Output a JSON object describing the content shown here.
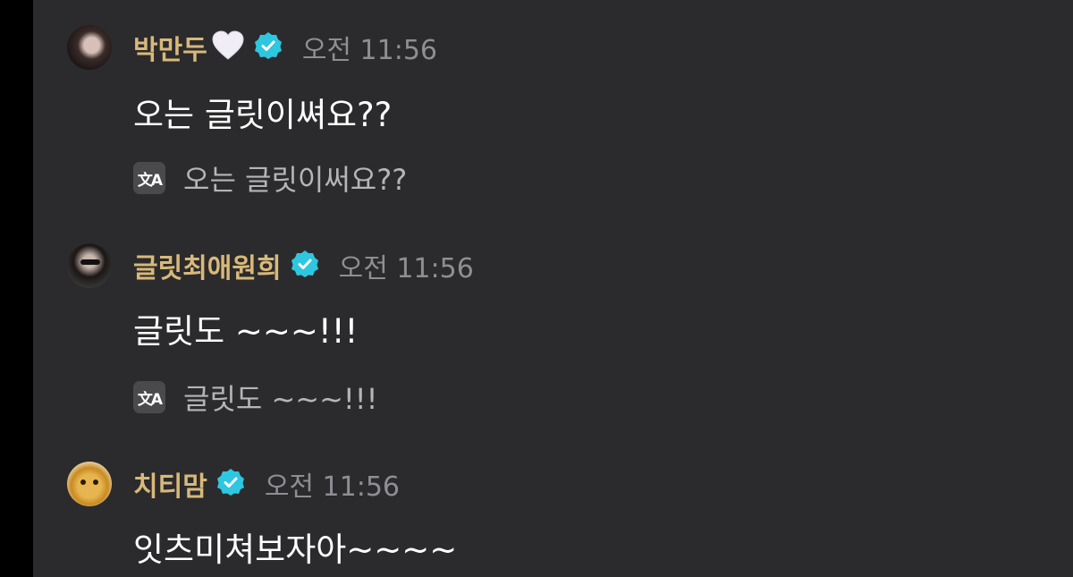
{
  "messages": [
    {
      "author": "박만두",
      "time": "오전 11:56",
      "text": "오는 글릿이쎠요??",
      "translation": "오는 글릿이써요??"
    },
    {
      "author": "글릿최애원희",
      "time": "오전 11:56",
      "text": "글릿도 ~~~!!!",
      "translation": "글릿도 ~~~!!!"
    },
    {
      "author": "치티맘",
      "time": "오전 11:56",
      "text": "잇츠미쳐보자아~~~~"
    }
  ],
  "icons": {
    "verified": "verified-badge-icon",
    "translate": "translate-icon",
    "heart": "white-heart-icon"
  },
  "colors": {
    "background": "#2b2b2d",
    "name": "#d8b97a",
    "verified": "#2fc6e0",
    "time": "#8e8e93"
  }
}
